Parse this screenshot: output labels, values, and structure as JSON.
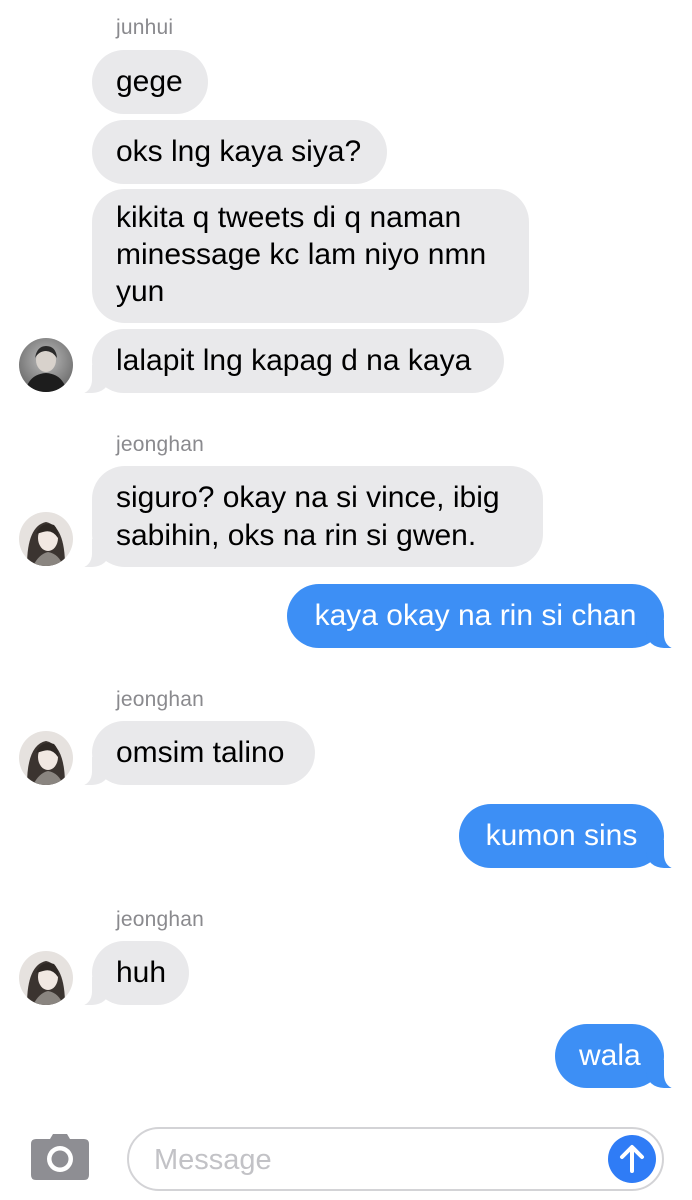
{
  "colors": {
    "incoming_bubble": "#e9e9eb",
    "outgoing_bubble": "#3d8ff5",
    "sender_name": "#8a8a8e",
    "send_button": "#2f7cf6"
  },
  "conversation": {
    "groups": [
      {
        "sender": "junhui",
        "messages": [
          "gege",
          "oks lng kaya siya?",
          "kikita q tweets di q naman\nminessage kc lam niyo nmn\nyun",
          "lalapit lng kapag d na kaya"
        ]
      },
      {
        "sender": "jeonghan",
        "messages": [
          "siguro? okay na si vince, ibig\nsabihin, oks na rin si gwen."
        ]
      },
      {
        "outgoing": "kaya okay na rin si chan"
      },
      {
        "sender": "jeonghan",
        "messages": [
          "omsim talino"
        ]
      },
      {
        "outgoing": "kumon sins"
      },
      {
        "sender": "jeonghan",
        "messages": [
          "huh"
        ]
      },
      {
        "outgoing": "wala"
      }
    ]
  },
  "icons": {
    "camera": "camera-icon",
    "send": "arrow-up-icon",
    "avatar_junhui": "avatar-junhui",
    "avatar_jeonghan": "avatar-jeonghan"
  },
  "composer": {
    "placeholder": "Message",
    "value": ""
  }
}
